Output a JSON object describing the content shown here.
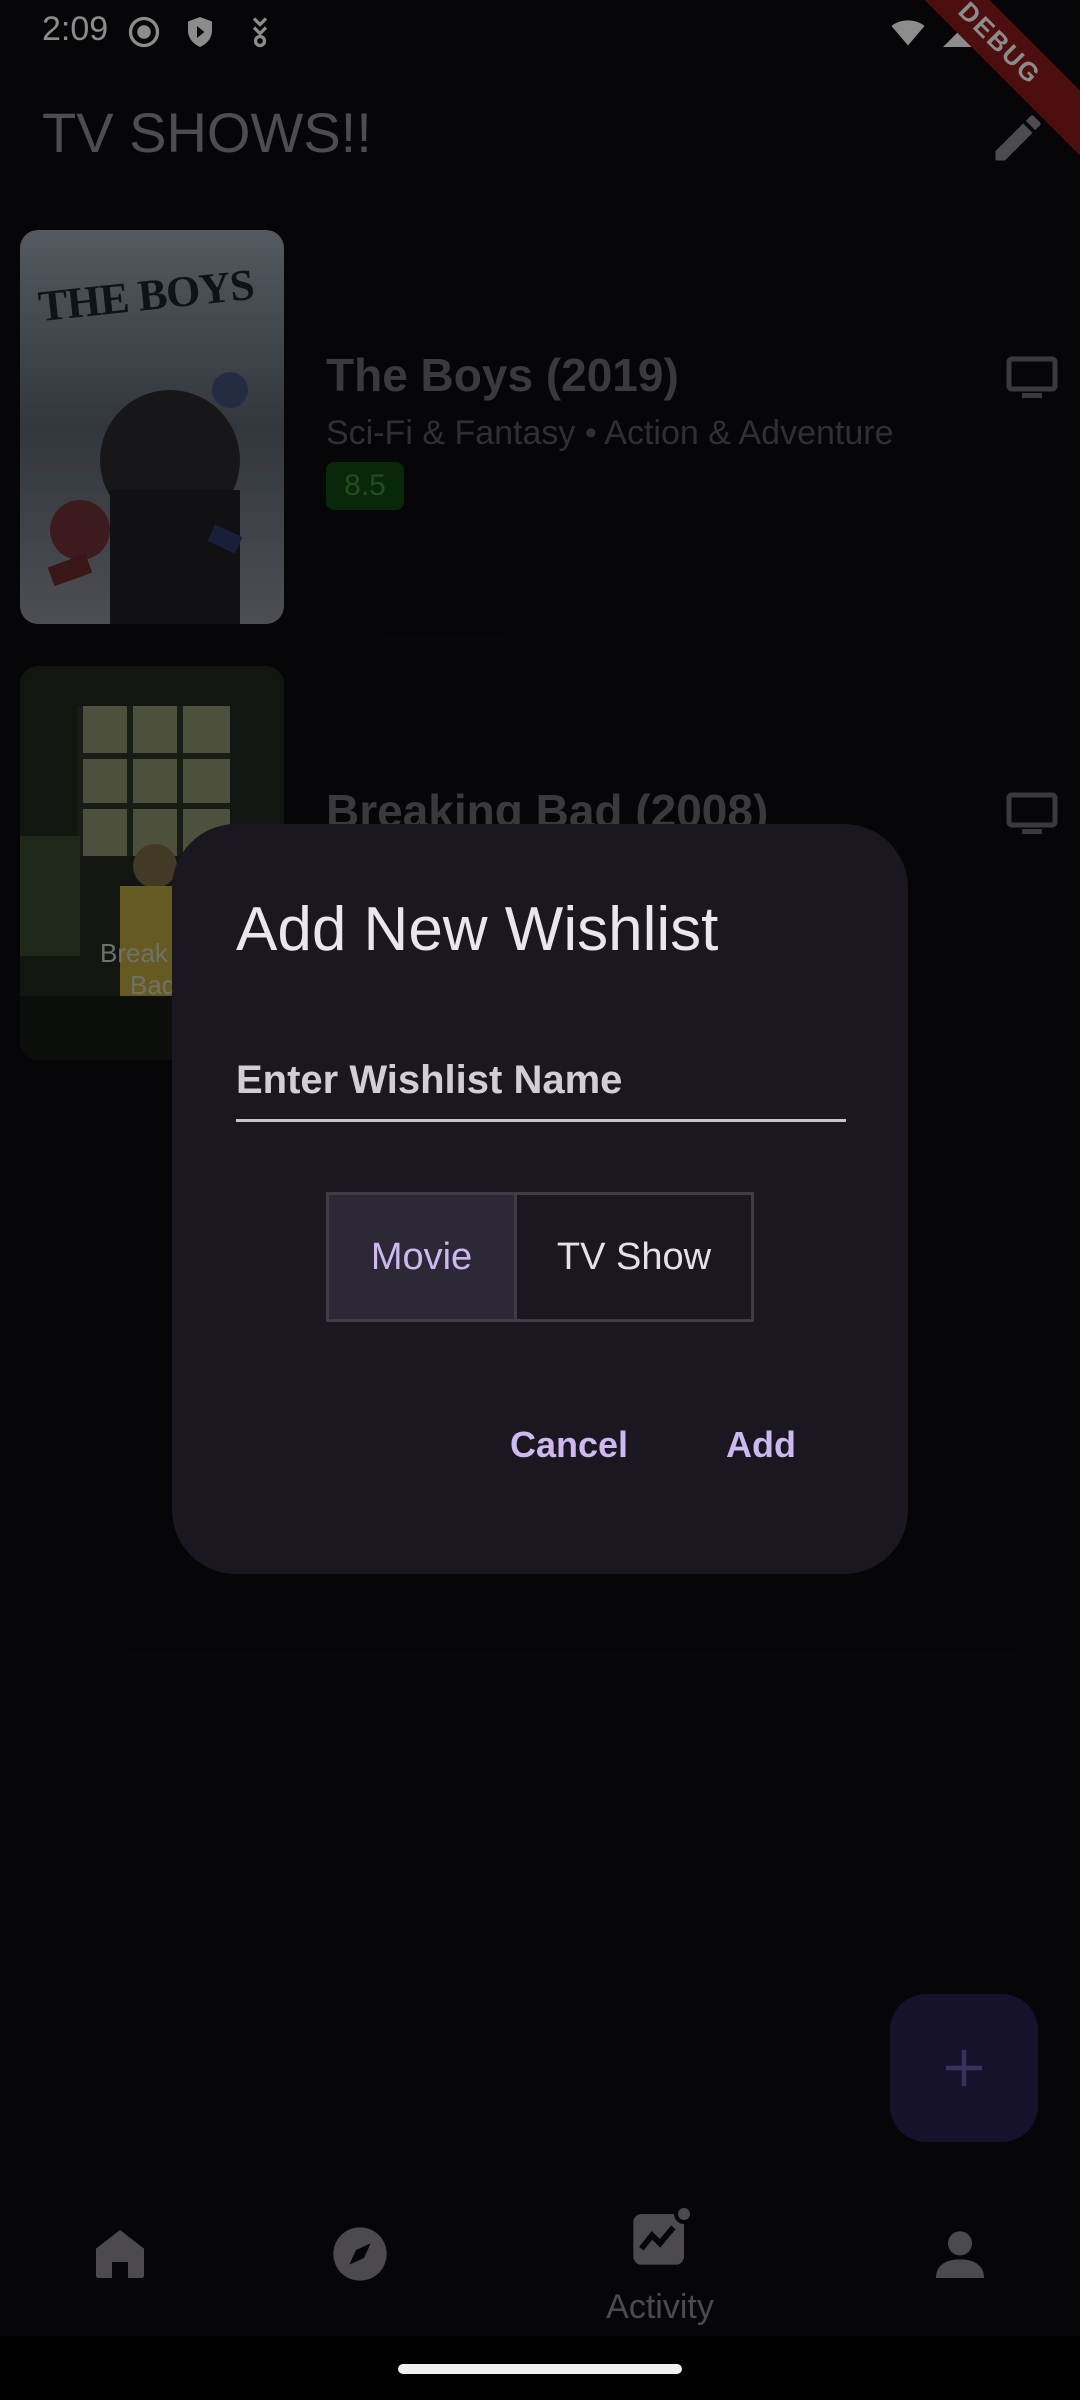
{
  "status_bar": {
    "time": "2:09",
    "debug_label": "DEBUG"
  },
  "app_bar": {
    "title": "TV SHOWS!!"
  },
  "shows": [
    {
      "title": "The Boys (2019)",
      "genres": "Sci-Fi & Fantasy • Action & Adventure",
      "rating": "8.5",
      "poster_text": "THE BOYS"
    },
    {
      "title": "Breaking Bad (2008)",
      "poster_text_line1": "Break",
      "poster_text_line2": "Bad"
    }
  ],
  "dialog": {
    "title": "Add New Wishlist",
    "input_placeholder": "Enter Wishlist Name",
    "input_value": "",
    "segments": [
      {
        "label": "Movie",
        "selected": true
      },
      {
        "label": "TV Show",
        "selected": false
      }
    ],
    "cancel_label": "Cancel",
    "add_label": "Add"
  },
  "bottom_nav": {
    "items": [
      {
        "icon": "home-icon",
        "label": ""
      },
      {
        "icon": "compass-icon",
        "label": ""
      },
      {
        "icon": "activity-icon",
        "label": "Activity"
      },
      {
        "icon": "person-icon",
        "label": ""
      }
    ]
  },
  "colors": {
    "accent": "#cdb8f0",
    "dialog_bg": "#1a1720",
    "rating_bg": "#0f4a12",
    "fab_bg": "#2b2150"
  }
}
